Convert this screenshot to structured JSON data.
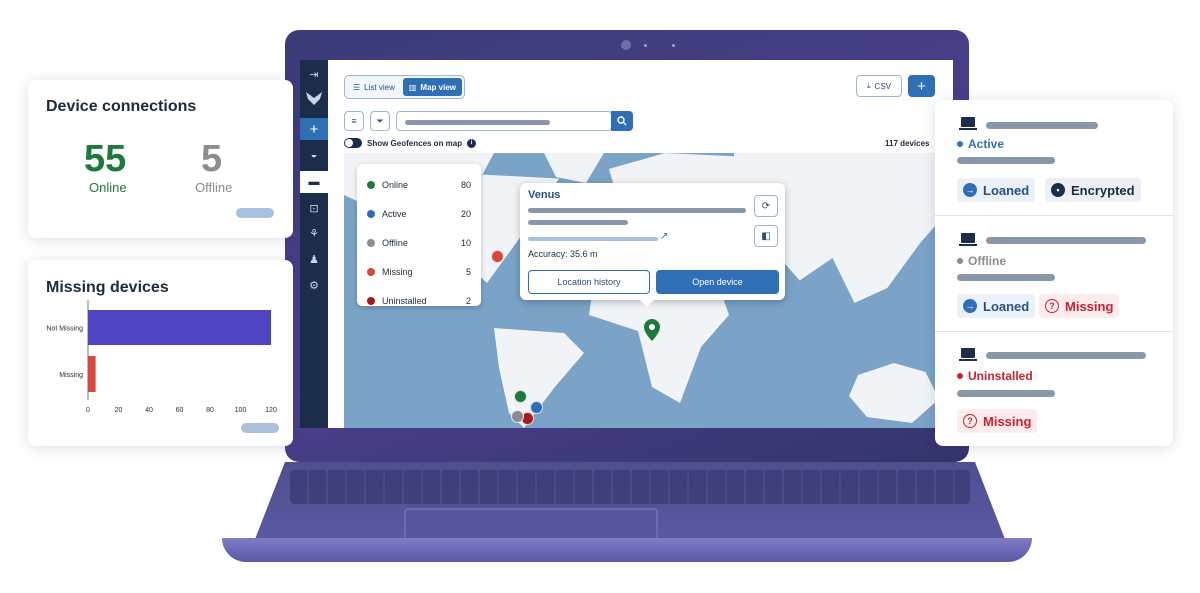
{
  "app": {
    "toolbar": {
      "list_view_label": "List view",
      "map_view_label": "Map view",
      "csv_label": "CSV",
      "add_label": "+",
      "show_geofences_label": "Show Geofences on map",
      "device_count_text": "117 devices"
    },
    "sidebar_icons": [
      "collapse-icon",
      "logo-icon",
      "add-icon",
      "dashboard-icon",
      "devices-icon",
      "robot-icon",
      "integrations-icon",
      "users-icon",
      "settings-icon"
    ],
    "legend": [
      {
        "label": "Online",
        "value": "80",
        "color": "#1e7a3c"
      },
      {
        "label": "Active",
        "value": "20",
        "color": "#2f6fb5"
      },
      {
        "label": "Offline",
        "value": "10",
        "color": "#8c8c8c"
      },
      {
        "label": "Missing",
        "value": "5",
        "color": "#d9463b"
      },
      {
        "label": "Uninstalled",
        "value": "2",
        "color": "#a31b1b"
      }
    ],
    "popup": {
      "title": "Venus",
      "accuracy_text": "Accuracy: 35.6 m",
      "location_history_label": "Location history",
      "open_device_label": "Open device"
    }
  },
  "device_connections": {
    "title": "Device connections",
    "online_count": "55",
    "online_label": "Online",
    "offline_count": "5",
    "offline_label": "Offline"
  },
  "missing_devices": {
    "title": "Missing devices"
  },
  "chart_data": {
    "type": "bar",
    "orientation": "horizontal",
    "categories": [
      "Not Missing",
      "Missing"
    ],
    "values": [
      120,
      5
    ],
    "xlim": [
      0,
      120
    ],
    "xticks": [
      "0",
      "20",
      "40",
      "60",
      "80",
      "100",
      "120"
    ],
    "colors": [
      "#4f44c2",
      "#d9463b"
    ]
  },
  "device_list": [
    {
      "status": "Active",
      "status_color": "#2f6fb5",
      "tags": [
        {
          "label": "Loaned",
          "icon": "arrow-right-icon"
        },
        {
          "label": "Encrypted",
          "icon": "lock-icon"
        }
      ]
    },
    {
      "status": "Offline",
      "status_color": "#8c8c8c",
      "tags": [
        {
          "label": "Loaned",
          "icon": "arrow-right-icon"
        },
        {
          "label": "Missing",
          "icon": "question-icon"
        }
      ]
    },
    {
      "status": "Uninstalled",
      "status_color": "#c8232e",
      "tags": [
        {
          "label": "Missing",
          "icon": "question-icon"
        }
      ]
    }
  ]
}
